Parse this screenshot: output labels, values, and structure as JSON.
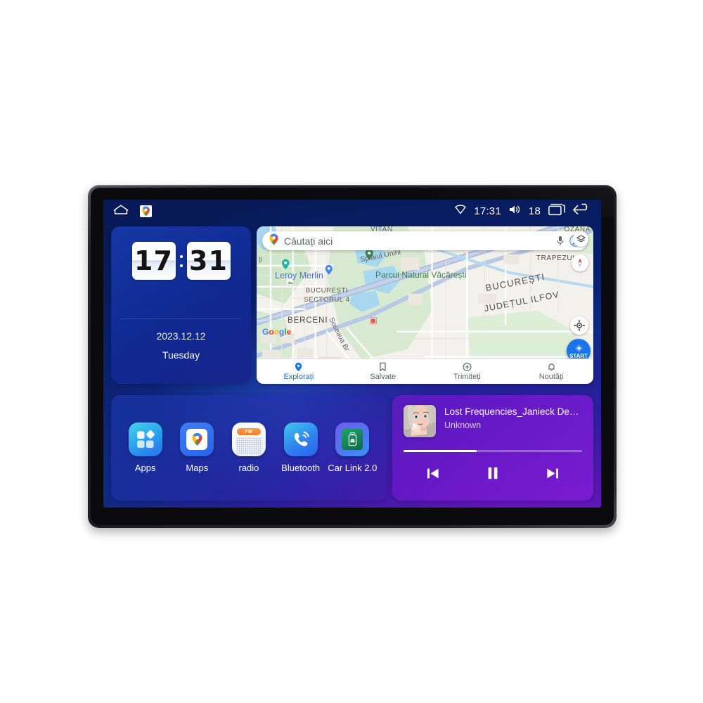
{
  "statusbar": {
    "home_icon": "home-icon",
    "app_icon": "google-maps-icon",
    "wifi_icon": "wifi-icon",
    "time": "17:31",
    "volume_icon": "volume-icon",
    "volume_level": "18",
    "recents_icon": "recents-icon",
    "back_icon": "back-icon"
  },
  "clock_widget": {
    "hours": "17",
    "minutes": "31",
    "date": "2023.12.12",
    "weekday": "Tuesday"
  },
  "map_widget": {
    "search": {
      "placeholder": "Căutați aici",
      "pin_icon": "google-maps-pin-icon",
      "mic_icon": "microphone-icon",
      "account_icon": "account-avatar-icon"
    },
    "controls": {
      "layers_icon": "map-layers-icon",
      "compass_icon": "compass-icon",
      "locate_icon": "my-location-icon",
      "start_label": "START",
      "start_icon": "navigation-arrow-icon"
    },
    "labels": [
      "OZANA",
      "TRAPEZULUI",
      "Splaiul Unirii",
      "Parcul Natural Văcărești",
      "Leroy Merlin",
      "BUCUREȘTI",
      "JUDEȚUL ILFOV",
      "BUCUREȘTI SECTORUL 4",
      "BERCENI",
      "Soseaua Br",
      "VITAN"
    ],
    "attribution": "Google",
    "tabs": [
      {
        "label": "Explorați",
        "icon": "location-pin-icon",
        "active": true
      },
      {
        "label": "Salvate",
        "icon": "bookmark-icon",
        "active": false
      },
      {
        "label": "Trimiteți",
        "icon": "plus-circle-icon",
        "active": false
      },
      {
        "label": "Noutăți",
        "icon": "bell-icon",
        "active": false
      }
    ]
  },
  "apps": [
    {
      "label": "Apps",
      "icon": "grid-apps-icon"
    },
    {
      "label": "Maps",
      "icon": "google-maps-icon"
    },
    {
      "label": "radio",
      "icon": "fm-radio-icon",
      "badge": "FM"
    },
    {
      "label": "Bluetooth",
      "icon": "phone-call-icon"
    },
    {
      "label": "Car Link 2.0",
      "icon": "car-link-icon"
    }
  ],
  "music": {
    "title": "Lost Frequencies_Janieck Devy-...",
    "artist": "Unknown",
    "album_art": "album-cover-portrait",
    "progress_percent": 41,
    "prev_icon": "previous-track-icon",
    "play_pause_icon": "pause-icon",
    "next_icon": "next-track-icon"
  },
  "colors": {
    "accent_blue": "#1a73e8",
    "music_purple": "#7018cd",
    "bg_blue": "#102a86"
  }
}
